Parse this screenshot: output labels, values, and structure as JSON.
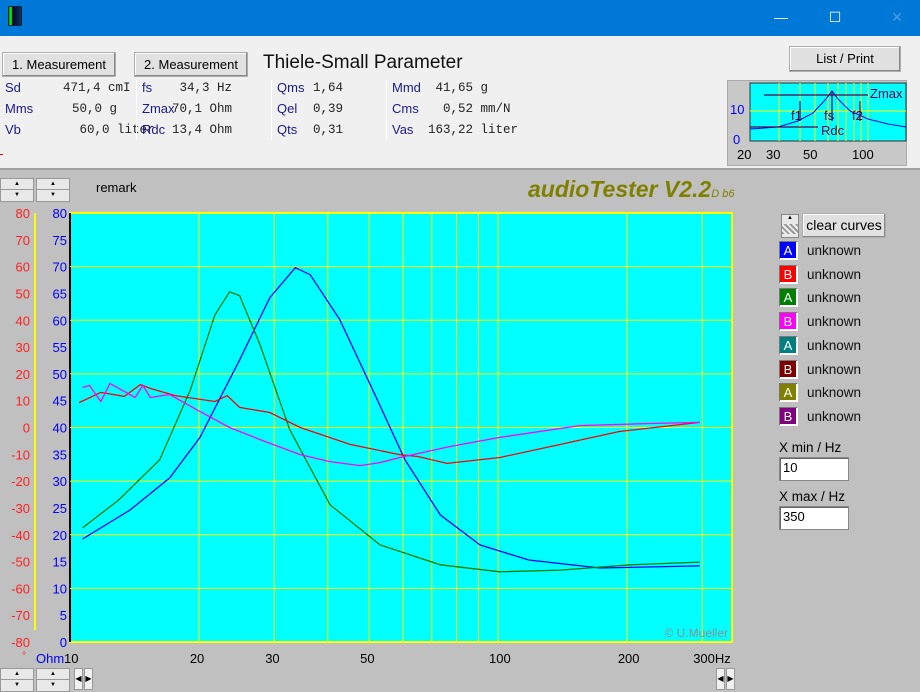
{
  "window": {
    "minimize": "—",
    "maximize": "☐",
    "close": "✕",
    "accent": "#0078d7"
  },
  "top": {
    "btn1": "1. Measurement",
    "btn2": "2. Measurement",
    "title": "Thiele-Small Parameter",
    "list_print": "List / Print",
    "params": [
      [
        {
          "k": "Sd",
          "v": "471,4 cmI"
        },
        {
          "k": "Mms",
          "v": "50,0 g"
        },
        {
          "k": "Vb",
          "v": " 60,0 liter"
        }
      ],
      [
        {
          "k": "fs",
          "v": " 34,3 Hz"
        },
        {
          "k": "Zmax",
          "v": "70,1 Ohm"
        },
        {
          "k": "Rdc",
          "v": "13,4 Ohm"
        }
      ],
      [
        {
          "k": "Qms",
          "v": "1,64"
        },
        {
          "k": "Qel",
          "v": "0,39"
        },
        {
          "k": "Qts",
          "v": "0,31"
        }
      ],
      [
        {
          "k": "Mmd",
          "v": " 41,65 g"
        },
        {
          "k": "Cms",
          "v": "  0,52 mm/N"
        },
        {
          "k": "Vas",
          "v": "163,22 liter"
        }
      ]
    ],
    "preview": {
      "zmax": "Zmax",
      "fs": "fs",
      "f1": "f1",
      "f2": "f2",
      "rdc": "Rdc",
      "y_ticks": [
        "10",
        "0"
      ],
      "x_ticks": [
        "20",
        "30",
        "50",
        "100"
      ]
    }
  },
  "remark": "remark",
  "brand": "audioTester V2.2",
  "brand_sub": "D b6",
  "copyright": "© U.Mueller",
  "clear_curves": "clear curves",
  "legend": [
    {
      "letter": "A",
      "label": "unknown",
      "color": "#0000ff"
    },
    {
      "letter": "B",
      "label": "unknown",
      "color": "#ff0000"
    },
    {
      "letter": "A",
      "label": "unknown",
      "color": "#008000"
    },
    {
      "letter": "B",
      "label": "unknown",
      "color": "#ff00ff"
    },
    {
      "letter": "A",
      "label": "unknown",
      "color": "#008080"
    },
    {
      "letter": "B",
      "label": "unknown",
      "color": "#800000"
    },
    {
      "letter": "A",
      "label": "unknown",
      "color": "#808000"
    },
    {
      "letter": "B",
      "label": "unknown",
      "color": "#800080"
    }
  ],
  "xmin": {
    "label": "X min / Hz",
    "value": "10"
  },
  "xmax": {
    "label": "X max / Hz",
    "value": "350"
  },
  "chart_data": {
    "type": "line",
    "xscale": "log",
    "xlim": [
      10,
      350
    ],
    "x_ticks": [
      {
        "v": 10,
        "t": "10"
      },
      {
        "v": 20,
        "t": "20"
      },
      {
        "v": 30,
        "t": "30"
      },
      {
        "v": 50,
        "t": "50"
      },
      {
        "v": 100,
        "t": "100"
      },
      {
        "v": 200,
        "t": "200"
      },
      {
        "v": 300,
        "t": "300Hz"
      }
    ],
    "x_grid": [
      20,
      30,
      40,
      50,
      60,
      70,
      80,
      90,
      100,
      200,
      300
    ],
    "ylim_ohm": [
      0,
      80
    ],
    "ylim_phase": [
      -80,
      80
    ],
    "y_unit_ohm": "Ohm",
    "y_unit_phase": "°",
    "y_ticks_ohm": [
      "80",
      "75",
      "70",
      "65",
      "60",
      "55",
      "50",
      "45",
      "40",
      "35",
      "30",
      "25",
      "20",
      "15",
      "10",
      "5",
      "0"
    ],
    "y_ticks_phase": [
      "80",
      "70",
      "60",
      "50",
      "40",
      "30",
      "20",
      "10",
      "0",
      "-10",
      "-20",
      "-30",
      "-40",
      "-50",
      "-60",
      "-70",
      "-80"
    ],
    "grid": true,
    "series": [
      {
        "axis": "ohm",
        "color": "#0000ff",
        "points": [
          [
            10.7,
            19.2
          ],
          [
            13.8,
            24.6
          ],
          [
            17.1,
            30.6
          ],
          [
            20.1,
            38.1
          ],
          [
            24.9,
            52.6
          ],
          [
            29.3,
            64.2
          ],
          [
            33.6,
            69.8
          ],
          [
            36.4,
            68.5
          ],
          [
            42.7,
            60.1
          ],
          [
            51.6,
            46.1
          ],
          [
            60.6,
            34.0
          ],
          [
            73.3,
            23.7
          ],
          [
            90.7,
            18.1
          ],
          [
            118,
            15.3
          ],
          [
            173,
            13.8
          ],
          [
            296,
            14.2
          ]
        ]
      },
      {
        "axis": "ohm",
        "color": "#008000",
        "points": [
          [
            10.7,
            21.3
          ],
          [
            13,
            26.5
          ],
          [
            16.2,
            34.0
          ],
          [
            19.1,
            47.0
          ],
          [
            21.8,
            61.0
          ],
          [
            23.6,
            65.3
          ],
          [
            24.9,
            64.6
          ],
          [
            27.8,
            55.4
          ],
          [
            32.6,
            39.6
          ],
          [
            40.5,
            25.6
          ],
          [
            53,
            18.1
          ],
          [
            73.3,
            14.4
          ],
          [
            101,
            13.1
          ],
          [
            140,
            13.4
          ],
          [
            204,
            14.4
          ],
          [
            296,
            14.9
          ]
        ]
      },
      {
        "axis": "phase",
        "color": "#ff0000",
        "points": [
          [
            10.5,
            9.3
          ],
          [
            11.8,
            13.1
          ],
          [
            13.4,
            11.6
          ],
          [
            14.6,
            16.0
          ],
          [
            15.4,
            14.6
          ],
          [
            17.6,
            11.9
          ],
          [
            21.8,
            9.7
          ],
          [
            23.3,
            11.9
          ],
          [
            24.9,
            7.5
          ],
          [
            29.3,
            5.6
          ],
          [
            34.5,
            0
          ],
          [
            45.1,
            -6.3
          ],
          [
            58.9,
            -10.1
          ],
          [
            65,
            -10.8
          ],
          [
            76,
            -13.4
          ],
          [
            101,
            -11.2
          ],
          [
            140,
            -6.3
          ],
          [
            192,
            -1.5
          ],
          [
            296,
            1.9
          ]
        ]
      },
      {
        "axis": "phase",
        "color": "#ff00ff",
        "points": [
          [
            10.7,
            14.9
          ],
          [
            11.1,
            15.7
          ],
          [
            11.8,
            9.7
          ],
          [
            12.4,
            16.4
          ],
          [
            14.2,
            11.2
          ],
          [
            14.8,
            15.7
          ],
          [
            15.4,
            11.2
          ],
          [
            17.1,
            12.3
          ],
          [
            20.1,
            6.0
          ],
          [
            23.6,
            0
          ],
          [
            27.8,
            -4.5
          ],
          [
            34.5,
            -10.1
          ],
          [
            40.5,
            -12.7
          ],
          [
            47.6,
            -14.2
          ],
          [
            53,
            -13.1
          ],
          [
            59,
            -11.2
          ],
          [
            77.3,
            -7.1
          ],
          [
            101,
            -3.7
          ],
          [
            155,
            0.7
          ],
          [
            227,
            1.5
          ],
          [
            296,
            1.9
          ]
        ]
      }
    ]
  }
}
